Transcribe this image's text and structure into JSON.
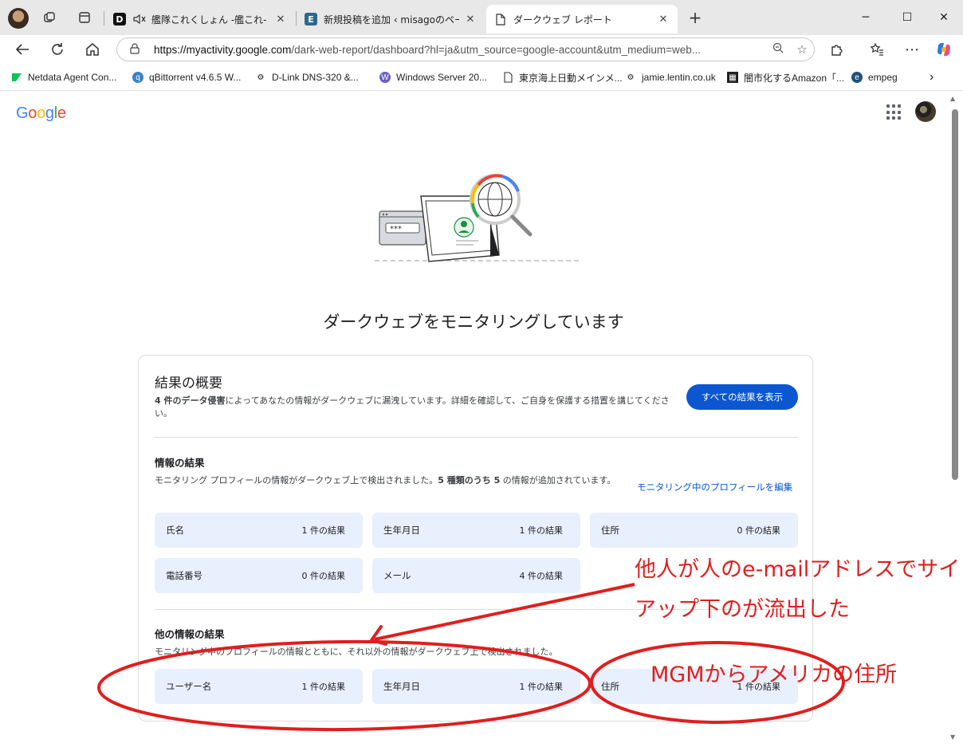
{
  "browser": {
    "tabs": [
      {
        "label": "艦隊これくしょん -艦これ- - オンラ",
        "favicon": "D"
      },
      {
        "label": "新規投稿を追加 ‹ misagoのページ –",
        "favicon": "E"
      },
      {
        "label": "ダークウェブ レポート",
        "favicon": "doc"
      }
    ],
    "new_tab": "+",
    "url_host": "https://myactivity.google.com",
    "url_path": "/dark-web-report/dashboard?hl=ja&utm_source=google-account&utm_medium=web...",
    "bookmarks": [
      "Netdata Agent Con...",
      "qBittorrent v4.6.5 W...",
      "D-Link DNS-320 &...",
      "Windows Server 20...",
      "東京海上日動メインメ...",
      "jamie.lentin.co.uk",
      "闇市化するAmazon「...",
      "empeg"
    ]
  },
  "page": {
    "logo": "Google",
    "hero_title": "ダークウェブをモニタリングしています",
    "summary": {
      "heading": "結果の概要",
      "count_bold": "4 件のデータ侵害",
      "text": "によってあなたの情報がダークウェブに漏洩しています。詳細を確認して、ご自身を保護する措置を講じてください。",
      "button": "すべての結果を表示"
    },
    "info_results": {
      "heading": "情報の結果",
      "desc_pre": "モニタリング プロフィールの情報がダークウェブ上で検出されました。",
      "desc_bold": "5 種類のうち 5",
      "desc_post": " の情報が追加されています。",
      "edit_link": "モニタリング中のプロフィールを編集",
      "items": [
        {
          "label": "氏名",
          "count": "1 件の結果"
        },
        {
          "label": "生年月日",
          "count": "1 件の結果"
        },
        {
          "label": "住所",
          "count": "0 件の結果"
        },
        {
          "label": "電話番号",
          "count": "0 件の結果"
        },
        {
          "label": "メール",
          "count": "4 件の結果"
        }
      ]
    },
    "other_results": {
      "heading": "他の情報の結果",
      "desc": "モニタリング中のプロフィールの情報とともに、それ以外の情報がダークウェブ上で検出されました。",
      "items": [
        {
          "label": "ユーザー名",
          "count": "1 件の結果"
        },
        {
          "label": "生年月日",
          "count": "1 件の結果"
        },
        {
          "label": "住所",
          "count": "1 件の結果"
        }
      ]
    }
  },
  "annotations": {
    "line1": "他人が人のe-mailアドレスでサイン",
    "line2": "アップ下のが流出した",
    "note2": "MGMからアメリカの住所",
    "color": "#e01e1e"
  }
}
